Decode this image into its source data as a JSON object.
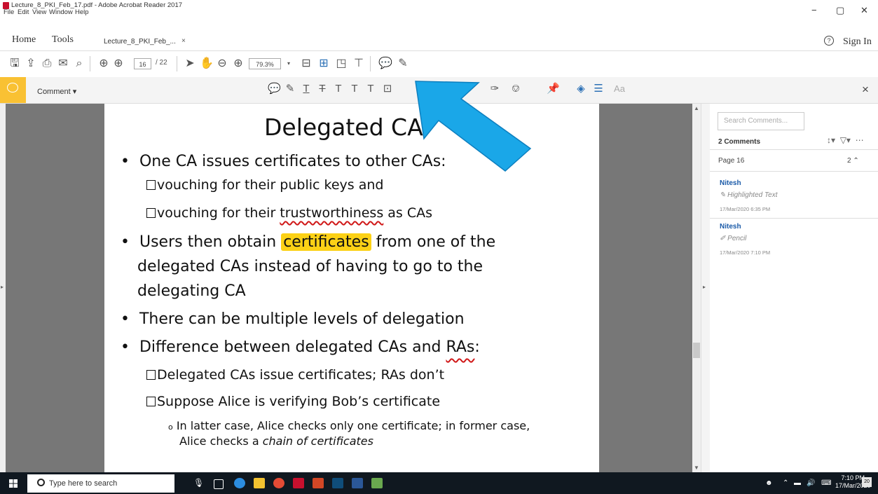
{
  "window": {
    "title": "Lecture_8_PKI_Feb_17.pdf - Adobe Acrobat Reader 2017",
    "minimize": "−",
    "maximize": "▢",
    "close": "✕"
  },
  "menu": [
    "File",
    "Edit",
    "View",
    "Window",
    "Help"
  ],
  "tabs": {
    "home": "Home",
    "tools": "Tools",
    "document": "Lecture_8_PKI_Feb_...",
    "document_close": "×",
    "sign_in": "Sign In"
  },
  "toolbar": {
    "page_current": "16",
    "page_total": "/ 22",
    "zoom": "79.3%"
  },
  "comment_bar": {
    "label": "Comment",
    "close": "×"
  },
  "slide": {
    "title": "Delegated CA",
    "bullet1": "One CA issues certificates to other CAs:",
    "sub1a": "vouching for their public keys and",
    "sub1b_pre": "vouching for their ",
    "sub1b_mark": "trustworthiness",
    "sub1b_post": " as CAs",
    "bullet2_pre": "Users then obtain ",
    "bullet2_mark": "certificates",
    "bullet2_post": " from one of the",
    "bullet2_l2": "delegated CAs instead of having to go to the",
    "bullet2_l3": "delegating CA",
    "bullet3": "There can be multiple levels of delegation",
    "bullet4_pre": "Difference between delegated CAs and ",
    "bullet4_mark": "RAs",
    "bullet4_post": ":",
    "sub4a": "Delegated CAs issue certificates; RAs don’t",
    "sub4b": "Suppose Alice is verifying Bob’s certificate",
    "sub4b_i_l1": "In latter case, Alice checks only one certificate; in former case,",
    "sub4b_i_l2_pre": "Alice checks a ",
    "sub4b_i_l2_em": "chain of certificates"
  },
  "comments_panel": {
    "search_placeholder": "Search Comments...",
    "count_label": "2 Comments",
    "page_group": "Page 16",
    "page_group_count": "2",
    "items": [
      {
        "author": "Nitesh",
        "type": "Highlighted Text",
        "time": "17/Mar/2020  6:35 PM"
      },
      {
        "author": "Nitesh",
        "type": "Pencil",
        "time": "17/Mar/2020  7:10 PM"
      }
    ]
  },
  "taskbar": {
    "search_placeholder": "Type here to search",
    "time": "7:10 PM",
    "date": "17/Mar/2020",
    "notifications": "20"
  },
  "colors": {
    "comment_accent": "#f9c133",
    "highlight": "#fcd116",
    "arrow": "#1aa7e8",
    "author": "#1a5aa8"
  }
}
